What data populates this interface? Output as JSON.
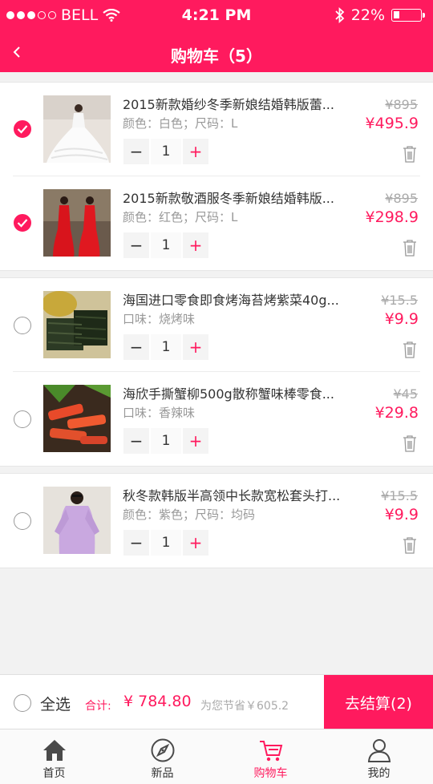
{
  "status_bar": {
    "carrier": "BELL",
    "time": "4:21 PM",
    "battery": "22%",
    "battery_level": 0.22
  },
  "nav": {
    "title": "购物车（5）"
  },
  "currency": "¥",
  "groups": [
    {
      "items": [
        {
          "name": "2015新款婚纱冬季新娘结婚韩版蕾...",
          "attr": "颜色：白色；尺码：L",
          "qty": "1",
          "old_price": "¥895",
          "price": "¥495.9",
          "checked": true
        },
        {
          "name": "2015新款敬酒服冬季新娘结婚韩版...",
          "attr": "颜色：红色；尺码：L",
          "qty": "1",
          "old_price": "¥895",
          "price": "¥298.9",
          "checked": true
        }
      ]
    },
    {
      "items": [
        {
          "name": "海国进口零食即食烤海苔烤紫菜40g...",
          "attr": "口味：烧烤味",
          "qty": "1",
          "old_price": "¥15.5",
          "price": "¥9.9",
          "checked": false
        },
        {
          "name": "海欣手撕蟹柳500g散称蟹味棒零食...",
          "attr": "口味：香辣味",
          "qty": "1",
          "old_price": "¥45",
          "price": "¥29.8",
          "checked": false
        }
      ]
    },
    {
      "items": [
        {
          "name": "秋冬款韩版半高领中长款宽松套头打...",
          "attr": "颜色：紫色；尺码：均码",
          "qty": "1",
          "old_price": "¥15.5",
          "price": "¥9.9",
          "checked": false
        }
      ]
    }
  ],
  "stepper": {
    "minus": "−",
    "plus": "+"
  },
  "checkout": {
    "select_all": "全选",
    "total_label": "合计:",
    "total": "¥ 784.80",
    "saved": "为您节省￥605.2",
    "button": "去结算(2)"
  },
  "tabbar": [
    {
      "label": "首页",
      "icon": "home-icon",
      "active": false
    },
    {
      "label": "新品",
      "icon": "compass-icon",
      "active": false
    },
    {
      "label": "购物车",
      "icon": "cart-icon",
      "active": true
    },
    {
      "label": "我的",
      "icon": "user-icon",
      "active": false
    }
  ],
  "colors": {
    "accent": "#ff1a5e",
    "muted": "#999999",
    "background": "#f2f2f2"
  }
}
